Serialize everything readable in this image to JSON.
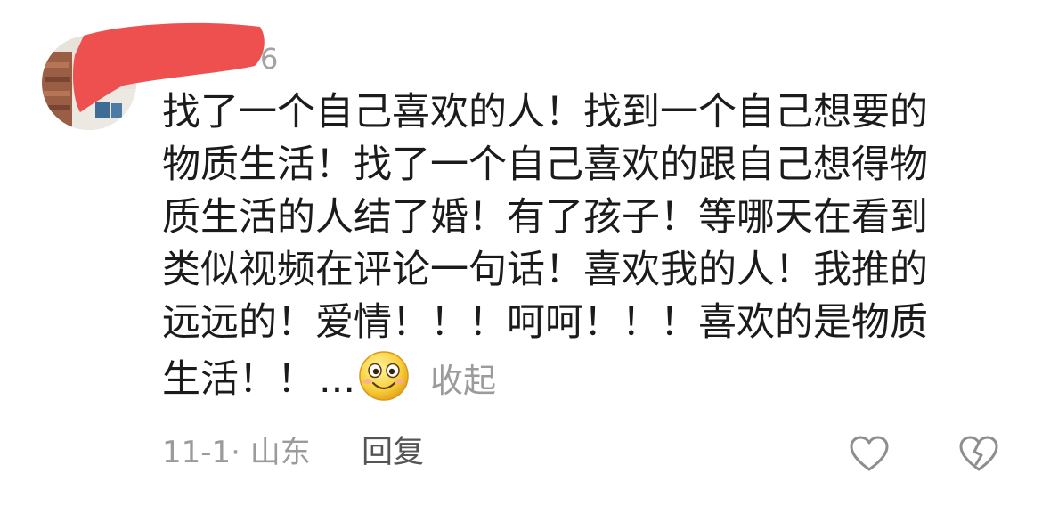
{
  "comment": {
    "username_tail": "6",
    "lines": [
      "找了一个自己喜欢的人！找到一个自己想要的",
      "物质生活！找了一个自己喜欢的跟自己想得物",
      "质生活的人结了婚！有了孩子！等哪天在看到",
      "类似视频在评论一句话！喜欢我的人！我推的",
      "远远的！爱情！！！呵呵！！！喜欢的是物质",
      "生活！！"
    ],
    "ellipsis": "...",
    "emoji": "smiley-emoji",
    "collapse_label": "收起"
  },
  "meta": {
    "date_location": "11-1· 山东",
    "reply_label": "回复"
  },
  "icons": {
    "like": "heart-outline-icon",
    "dislike": "broken-heart-icon"
  },
  "colors": {
    "redaction": "#ee4f4f",
    "text": "#1b1b1b",
    "secondary": "#9b9b9b",
    "icon": "#8e8e8e"
  }
}
